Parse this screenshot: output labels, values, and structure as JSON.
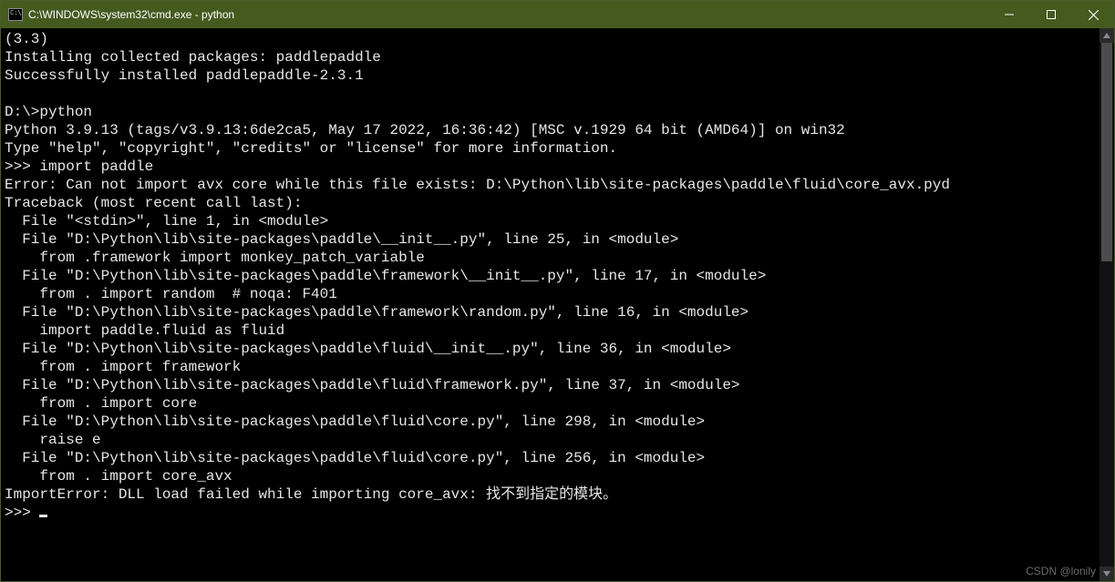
{
  "titlebar": {
    "title": "C:\\WINDOWS\\system32\\cmd.exe - python"
  },
  "terminal": {
    "lines": [
      "(3.3)",
      "Installing collected packages: paddlepaddle",
      "Successfully installed paddlepaddle-2.3.1",
      "",
      "D:\\>python",
      "Python 3.9.13 (tags/v3.9.13:6de2ca5, May 17 2022, 16:36:42) [MSC v.1929 64 bit (AMD64)] on win32",
      "Type \"help\", \"copyright\", \"credits\" or \"license\" for more information.",
      ">>> import paddle",
      "Error: Can not import avx core while this file exists: D:\\Python\\lib\\site-packages\\paddle\\fluid\\core_avx.pyd",
      "Traceback (most recent call last):",
      "  File \"<stdin>\", line 1, in <module>",
      "  File \"D:\\Python\\lib\\site-packages\\paddle\\__init__.py\", line 25, in <module>",
      "    from .framework import monkey_patch_variable",
      "  File \"D:\\Python\\lib\\site-packages\\paddle\\framework\\__init__.py\", line 17, in <module>",
      "    from . import random  # noqa: F401",
      "  File \"D:\\Python\\lib\\site-packages\\paddle\\framework\\random.py\", line 16, in <module>",
      "    import paddle.fluid as fluid",
      "  File \"D:\\Python\\lib\\site-packages\\paddle\\fluid\\__init__.py\", line 36, in <module>",
      "    from . import framework",
      "  File \"D:\\Python\\lib\\site-packages\\paddle\\fluid\\framework.py\", line 37, in <module>",
      "    from . import core",
      "  File \"D:\\Python\\lib\\site-packages\\paddle\\fluid\\core.py\", line 298, in <module>",
      "    raise e",
      "  File \"D:\\Python\\lib\\site-packages\\paddle\\fluid\\core.py\", line 256, in <module>",
      "    from . import core_avx",
      "ImportError: DLL load failed while importing core_avx: 找不到指定的模块。",
      ">>> "
    ]
  },
  "watermark": "CSDN @lonily"
}
